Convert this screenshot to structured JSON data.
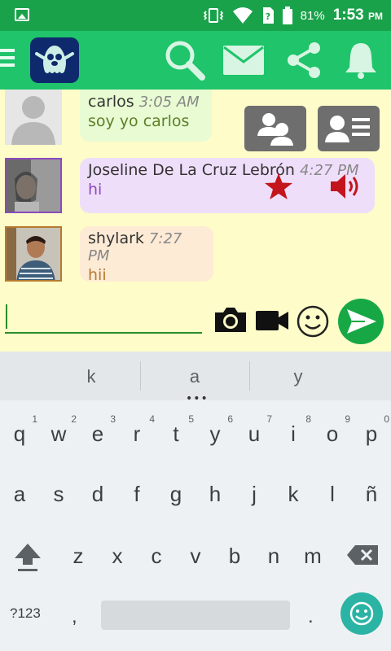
{
  "status_bar": {
    "battery_percent": "81%",
    "time": "1:53",
    "ampm": "PM"
  },
  "app_bar": {
    "icons": [
      "menu-icon",
      "app-logo",
      "search-icon",
      "mail-icon",
      "share-icon",
      "bell-icon"
    ]
  },
  "messages": [
    {
      "name": "carlos",
      "time": "3:05 AM",
      "text": "soy yo carlos",
      "bubble_color": "#e8fbd2",
      "text_color": "#5e7f2a"
    },
    {
      "name": "Joseline De La Cruz Lebrón",
      "time": "4:27 PM",
      "text": "hi",
      "bubble_color": "#efdefa",
      "text_color": "#8a4bbd"
    },
    {
      "name": "shylark",
      "time": "7:27 PM",
      "text": "hii",
      "bubble_color": "#fdebd6",
      "text_color": "#b57a2f"
    }
  ],
  "message_actions": [
    "group-icon",
    "contact-card-icon",
    "star-icon",
    "speaker-icon"
  ],
  "composer": {
    "placeholder": "",
    "value": "",
    "icons": [
      "camera-icon",
      "video-icon",
      "emoji-icon",
      "send-icon"
    ]
  },
  "keyboard": {
    "suggestions": [
      "k",
      "a",
      "y"
    ],
    "row1": [
      "q",
      "w",
      "e",
      "r",
      "t",
      "y",
      "u",
      "i",
      "o",
      "p"
    ],
    "row1_digits": [
      "1",
      "2",
      "3",
      "4",
      "5",
      "6",
      "7",
      "8",
      "9",
      "0"
    ],
    "row2": [
      "a",
      "s",
      "d",
      "f",
      "g",
      "h",
      "j",
      "k",
      "l",
      "ñ"
    ],
    "row3": [
      "z",
      "x",
      "c",
      "v",
      "b",
      "n",
      "m"
    ],
    "symbols_label": "?123",
    "comma": ",",
    "period": "."
  },
  "colors": {
    "status_bar": "#1aa24a",
    "app_bar": "#1fc46b",
    "chat_background": "#fefcc9",
    "star": "#c3151b",
    "speaker": "#c3151b",
    "send": "#17a845"
  }
}
